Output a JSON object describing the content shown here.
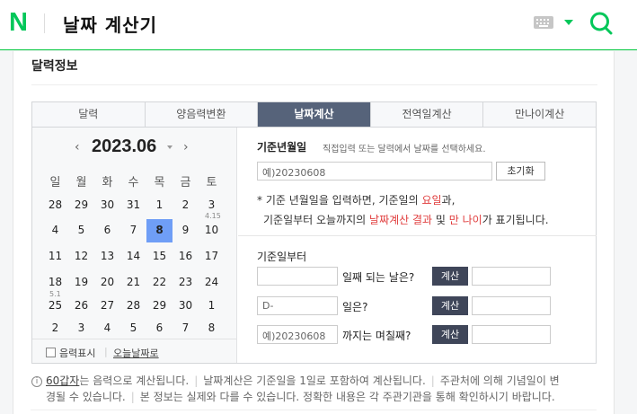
{
  "header": {
    "logo": "N",
    "title": "날짜 계산기"
  },
  "section_title": "달력정보",
  "tabs": [
    "달력",
    "양음력변환",
    "날짜계산",
    "전역일계산",
    "만나이계산"
  ],
  "active_tab": 2,
  "calendar": {
    "prev": "‹",
    "next": "›",
    "month_label": "2023.06",
    "weekdays": [
      "일",
      "월",
      "화",
      "수",
      "목",
      "금",
      "토"
    ],
    "weeks": [
      [
        "28",
        "29",
        "30",
        "31",
        "1",
        "2",
        "3"
      ],
      [
        "4",
        "5",
        "6",
        "7",
        "8",
        "9",
        "10"
      ],
      [
        "11",
        "12",
        "13",
        "14",
        "15",
        "16",
        "17"
      ],
      [
        "18",
        "19",
        "20",
        "21",
        "22",
        "23",
        "24"
      ],
      [
        "25",
        "26",
        "27",
        "28",
        "29",
        "30",
        "1"
      ],
      [
        "2",
        "3",
        "4",
        "5",
        "6",
        "7",
        "8"
      ]
    ],
    "lunar_notes": [
      "4.15",
      "5.1"
    ],
    "lunar_toggle": "음력표시",
    "today_link": "오늘날짜로"
  },
  "form": {
    "base_label": "기준년월일",
    "base_hint": "직접입력 또는 달력에서 날짜를 선택하세요.",
    "base_placeholder": "예)20230608",
    "reset_button": "초기화",
    "note_line1_a": "* 기준 년월일을 입력하면, 기준일의 ",
    "note_line1_b": "요일",
    "note_line1_c": "과,",
    "note_line2_a": "기준일부터 오늘까지의 ",
    "note_line2_b": "날짜계산 결과",
    "note_line2_c": " 및 ",
    "note_line2_d": "만 나이",
    "note_line2_e": "가 표기됩니다.",
    "from_label": "기준일부터",
    "row1_label": "일째 되는 날은?",
    "row2_placeholder": "D-",
    "row2_label": "일은?",
    "row3_placeholder": "예)20230608",
    "row3_label": "까지는 며칠째?",
    "calc_button": "계산"
  },
  "footer": {
    "info_icon": "i",
    "link": "60갑자",
    "t1": "는 음력으로 계산됩니다.",
    "t2": "날짜계산은 기준일을 1일로 포함하여 계산됩니다.",
    "t3a": "주관처에 의해 기념일이 변",
    "t3b": "경될 수 있습니다.",
    "t4": "본 정보는 실제와 다를 수 있습니다. 정확한 내용은 각 주관기관을 통해 확인하시기 바랍니다."
  }
}
